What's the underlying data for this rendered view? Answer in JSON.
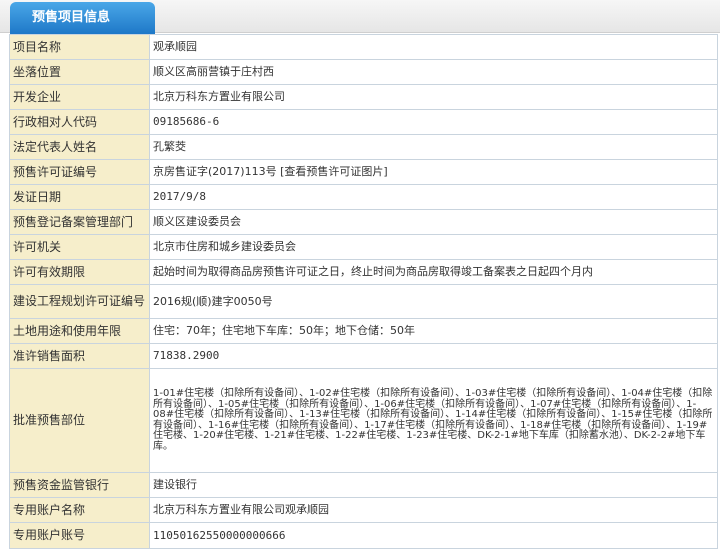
{
  "tab": {
    "title": "预售项目信息"
  },
  "rows": [
    {
      "label": "项目名称",
      "value": "观承顺园"
    },
    {
      "label": "坐落位置",
      "value": "顺义区高丽营镇于庄村西"
    },
    {
      "label": "开发企业",
      "value": "北京万科东方置业有限公司"
    },
    {
      "label": "行政相对人代码",
      "value": "09185686-6"
    },
    {
      "label": "法定代表人姓名",
      "value": "孔繁茭"
    },
    {
      "label": "预售许可证编号",
      "value": "京房售证字(2017)113号 [查看预售许可证图片]"
    },
    {
      "label": "发证日期",
      "value": "2017/9/8"
    },
    {
      "label": "预售登记备案管理部门",
      "value": "顺义区建设委员会"
    },
    {
      "label": "许可机关",
      "value": "北京市住房和城乡建设委员会"
    },
    {
      "label": "许可有效期限",
      "value": "起始时间为取得商品房预售许可证之日，终止时间为商品房取得竣工备案表之日起四个月内"
    },
    {
      "label": "建设工程规划许可证编号",
      "value": "2016规(顺)建字0050号"
    },
    {
      "label": "土地用途和使用年限",
      "value": "住宅：70年；住宅地下车库：50年；地下仓储：50年"
    },
    {
      "label": "准许销售面积",
      "value": "71838.2900"
    },
    {
      "label": "批准预售部位",
      "value": "1-01#住宅楼（扣除所有设备间）、1-02#住宅楼（扣除所有设备间）、1-03#住宅楼（扣除所有设备间）、1-04#住宅楼（扣除所有设备间）、1-05#住宅楼（扣除所有设备间）、1-06#住宅楼（扣除所有设备间）、1-07#住宅楼（扣除所有设备间）、1-08#住宅楼（扣除所有设备间）、1-13#住宅楼（扣除所有设备间）、1-14#住宅楼（扣除所有设备间）、1-15#住宅楼（扣除所有设备间）、1-16#住宅楼（扣除所有设备间）、1-17#住宅楼（扣除所有设备间）、1-18#住宅楼（扣除所有设备间）、1-19#住宅楼、1-20#住宅楼、1-21#住宅楼、1-22#住宅楼、1-23#住宅楼、DK-2-1#地下车库（扣除蓄水池）、DK-2-2#地下车库。"
    },
    {
      "label": "预售资金监管银行",
      "value": "建设银行"
    },
    {
      "label": "专用账户名称",
      "value": "北京万科东方置业有限公司观承顺园"
    },
    {
      "label": "专用账户账号",
      "value": "11050162550000000666"
    }
  ]
}
